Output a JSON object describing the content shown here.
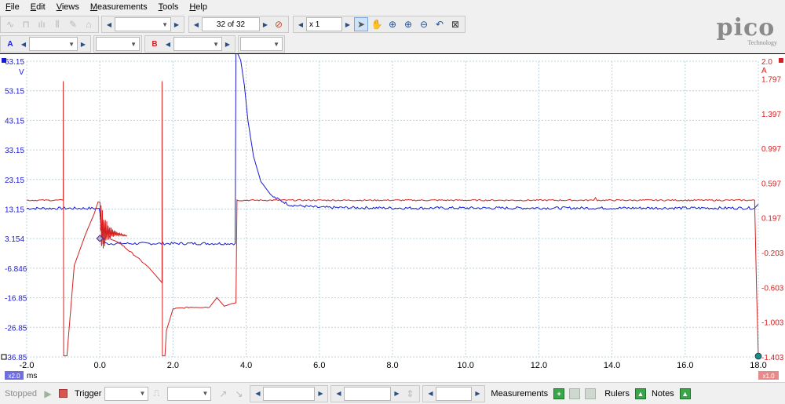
{
  "menu": [
    "File",
    "Edit",
    "Views",
    "Measurements",
    "Tools",
    "Help"
  ],
  "toolbar": {
    "buffer_position": "32 of 32",
    "zoom_factor": "x 1",
    "channel_a": "A",
    "channel_b": "B"
  },
  "logo": {
    "word": "pico",
    "sub": "Technology"
  },
  "chart_data": {
    "type": "line",
    "xlabel": "ms",
    "x_range": [
      -2.0,
      18.0
    ],
    "x_ticks": [
      "-2.0",
      "0.0",
      "2.0",
      "4.0",
      "6.0",
      "8.0",
      "10.0",
      "12.0",
      "14.0",
      "16.0",
      "18.0"
    ],
    "left_axis": {
      "unit": "V",
      "range": [
        -36.85,
        63.15
      ],
      "ticks": [
        "63.15",
        "53.15",
        "43.15",
        "33.15",
        "23.15",
        "13.15",
        "3.154",
        "-6.846",
        "-16.85",
        "-26.85",
        "-36.85"
      ],
      "color": "#1a1ad4"
    },
    "right_axis": {
      "unit": "A",
      "range": [
        -1.403,
        2.0
      ],
      "ticks": [
        "2.0",
        "1.797",
        "1.397",
        "0.997",
        "0.597",
        "0.197",
        "-0.203",
        "-0.603",
        "-1.003",
        "-1.403"
      ],
      "color": "#d42020"
    },
    "left_scale_badge": "x2.0",
    "right_scale_badge": "x1.0",
    "grid": true,
    "series": [
      {
        "axis": "left",
        "color": "#1a1ad4",
        "points": [
          [
            -2.0,
            13.4
          ],
          [
            -0.02,
            13.4
          ],
          [
            0.0,
            12.0
          ],
          [
            0.05,
            5.0
          ],
          [
            0.15,
            1.5
          ],
          [
            1.0,
            1.5
          ],
          [
            2.0,
            1.5
          ],
          [
            3.7,
            1.5
          ],
          [
            3.72,
            67.0
          ],
          [
            3.85,
            63.5
          ],
          [
            3.95,
            55.0
          ],
          [
            4.05,
            43.0
          ],
          [
            4.2,
            31.0
          ],
          [
            4.4,
            22.5
          ],
          [
            4.7,
            17.5
          ],
          [
            5.2,
            14.5
          ],
          [
            6.0,
            13.7
          ],
          [
            8.0,
            13.5
          ],
          [
            12.0,
            13.5
          ],
          [
            17.9,
            13.5
          ],
          [
            18.0,
            14.8
          ]
        ]
      },
      {
        "axis": "right",
        "color": "#d42020",
        "points": [
          [
            -2.0,
            0.4
          ],
          [
            -1.0,
            0.4
          ],
          [
            -1.0,
            1.77
          ],
          [
            -0.99,
            -1.39
          ],
          [
            -0.9,
            -1.39
          ],
          [
            -0.7,
            -0.35
          ],
          [
            -0.4,
            -0.0
          ],
          [
            -0.15,
            0.25
          ],
          [
            -0.05,
            0.38
          ],
          [
            0.0,
            0.38
          ],
          [
            0.05,
            0.1
          ],
          [
            0.1,
            -0.1
          ],
          [
            0.2,
            0.05
          ],
          [
            0.3,
            -0.05
          ],
          [
            0.5,
            -0.08
          ],
          [
            1.0,
            -0.25
          ],
          [
            1.35,
            -0.38
          ],
          [
            1.6,
            -0.5
          ],
          [
            1.7,
            -0.55
          ],
          [
            1.7,
            1.77
          ],
          [
            1.71,
            -1.39
          ],
          [
            1.78,
            -1.39
          ],
          [
            1.82,
            -1.1
          ],
          [
            2.0,
            -0.85
          ],
          [
            2.5,
            -0.83
          ],
          [
            3.0,
            -0.83
          ],
          [
            3.2,
            -0.72
          ],
          [
            3.4,
            -0.82
          ],
          [
            3.6,
            -0.79
          ],
          [
            3.72,
            -0.78
          ],
          [
            3.75,
            0.4
          ],
          [
            6.0,
            0.4
          ],
          [
            13.5,
            0.4
          ],
          [
            13.55,
            0.43
          ],
          [
            13.6,
            0.4
          ],
          [
            17.9,
            0.4
          ],
          [
            17.95,
            -0.6
          ],
          [
            18.0,
            -1.39
          ]
        ]
      }
    ]
  },
  "status": {
    "stopped": "Stopped",
    "trigger": "Trigger",
    "measurements": "Measurements",
    "rulers": "Rulers",
    "notes": "Notes"
  }
}
